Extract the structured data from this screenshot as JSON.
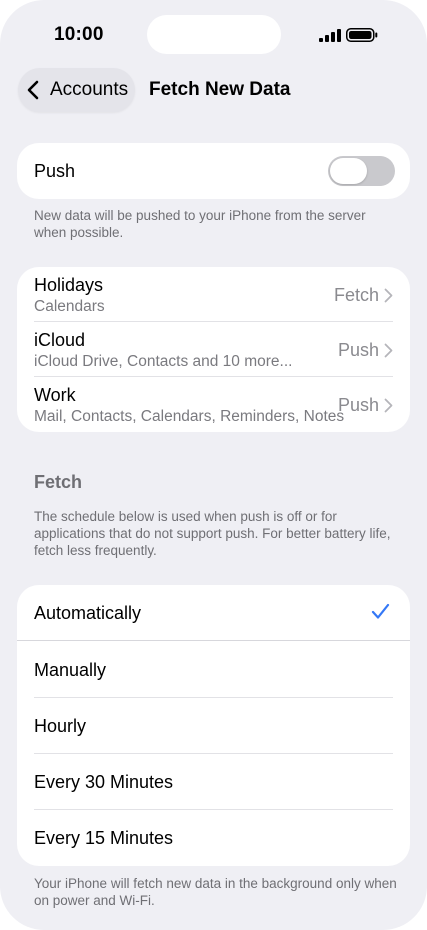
{
  "status_bar": {
    "time": "10:00"
  },
  "nav": {
    "back_label": "Accounts",
    "title": "Fetch New Data"
  },
  "push": {
    "label": "Push",
    "enabled": false,
    "footnote": "New data will be pushed to your iPhone from the server when possible."
  },
  "accounts": [
    {
      "title": "Holidays",
      "subtitle": "Calendars",
      "value": "Fetch"
    },
    {
      "title": "iCloud",
      "subtitle": "iCloud Drive, Contacts and 10 more...",
      "value": "Push"
    },
    {
      "title": "Work",
      "subtitle": "Mail, Contacts, Calendars, Reminders, Notes",
      "value": "Push"
    }
  ],
  "fetch": {
    "header": "Fetch",
    "description": "The schedule below is used when push is off or for applications that do not support push. For better battery life, fetch less frequently.",
    "options": [
      {
        "label": "Automatically",
        "selected": true
      },
      {
        "label": "Manually",
        "selected": false
      },
      {
        "label": "Hourly",
        "selected": false
      },
      {
        "label": "Every 30 Minutes",
        "selected": false
      },
      {
        "label": "Every 15 Minutes",
        "selected": false
      }
    ],
    "footnote": "Your iPhone will fetch new data in the background only when on power and Wi-Fi."
  },
  "colors": {
    "accent": "#3478f6",
    "background": "#efeff4",
    "card": "#ffffff",
    "secondary_text": "#6f6f74"
  },
  "icons": {
    "back": "chevron-left-icon",
    "disclosure": "chevron-right-icon",
    "check": "checkmark-icon",
    "signal": "cellular-signal-icon",
    "battery": "battery-icon"
  }
}
